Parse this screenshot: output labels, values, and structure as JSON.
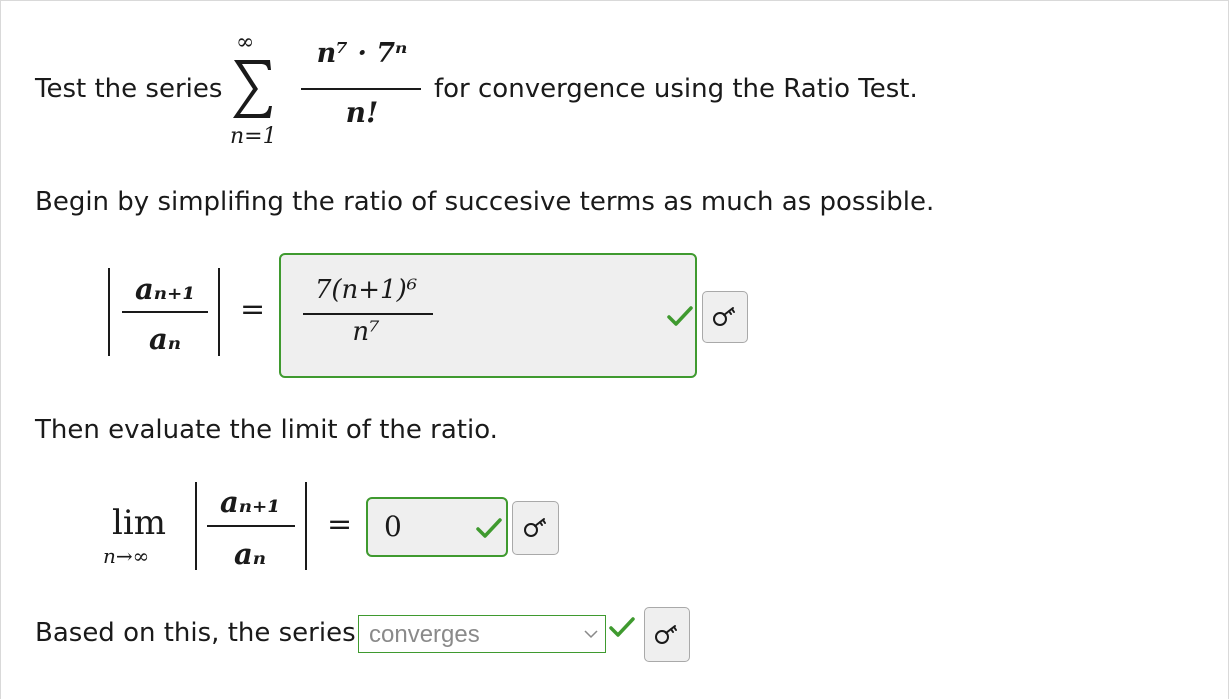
{
  "problem": {
    "intro_prefix": "Test the series",
    "intro_suffix": "for convergence using the Ratio Test.",
    "sum_upper": "∞",
    "sum_lower": "n=1",
    "numerator": "n⁷ · 7ⁿ",
    "denominator": "n!"
  },
  "step1": {
    "instruction": "Begin by simplifing the ratio of succesive terms as much as possible.",
    "lhs_numerator": "aₙ₊₁",
    "lhs_denominator": "aₙ",
    "equals": "=",
    "answer_numerator": "7(n+1)⁶",
    "answer_denominator": "n⁷"
  },
  "step2": {
    "instruction": "Then evaluate the limit of the ratio.",
    "lim": "lim",
    "lim_sub": "n→∞",
    "lhs_numerator": "aₙ₊₁",
    "lhs_denominator": "aₙ",
    "equals": "=",
    "answer": "0"
  },
  "step3": {
    "prefix": "Based on this, the series",
    "selected": "converges"
  },
  "colors": {
    "correct": "#3f9a2f",
    "field_bg": "#efefef"
  },
  "icons": [
    "sigma-icon",
    "check-icon",
    "key-icon",
    "chevron-down-icon"
  ]
}
